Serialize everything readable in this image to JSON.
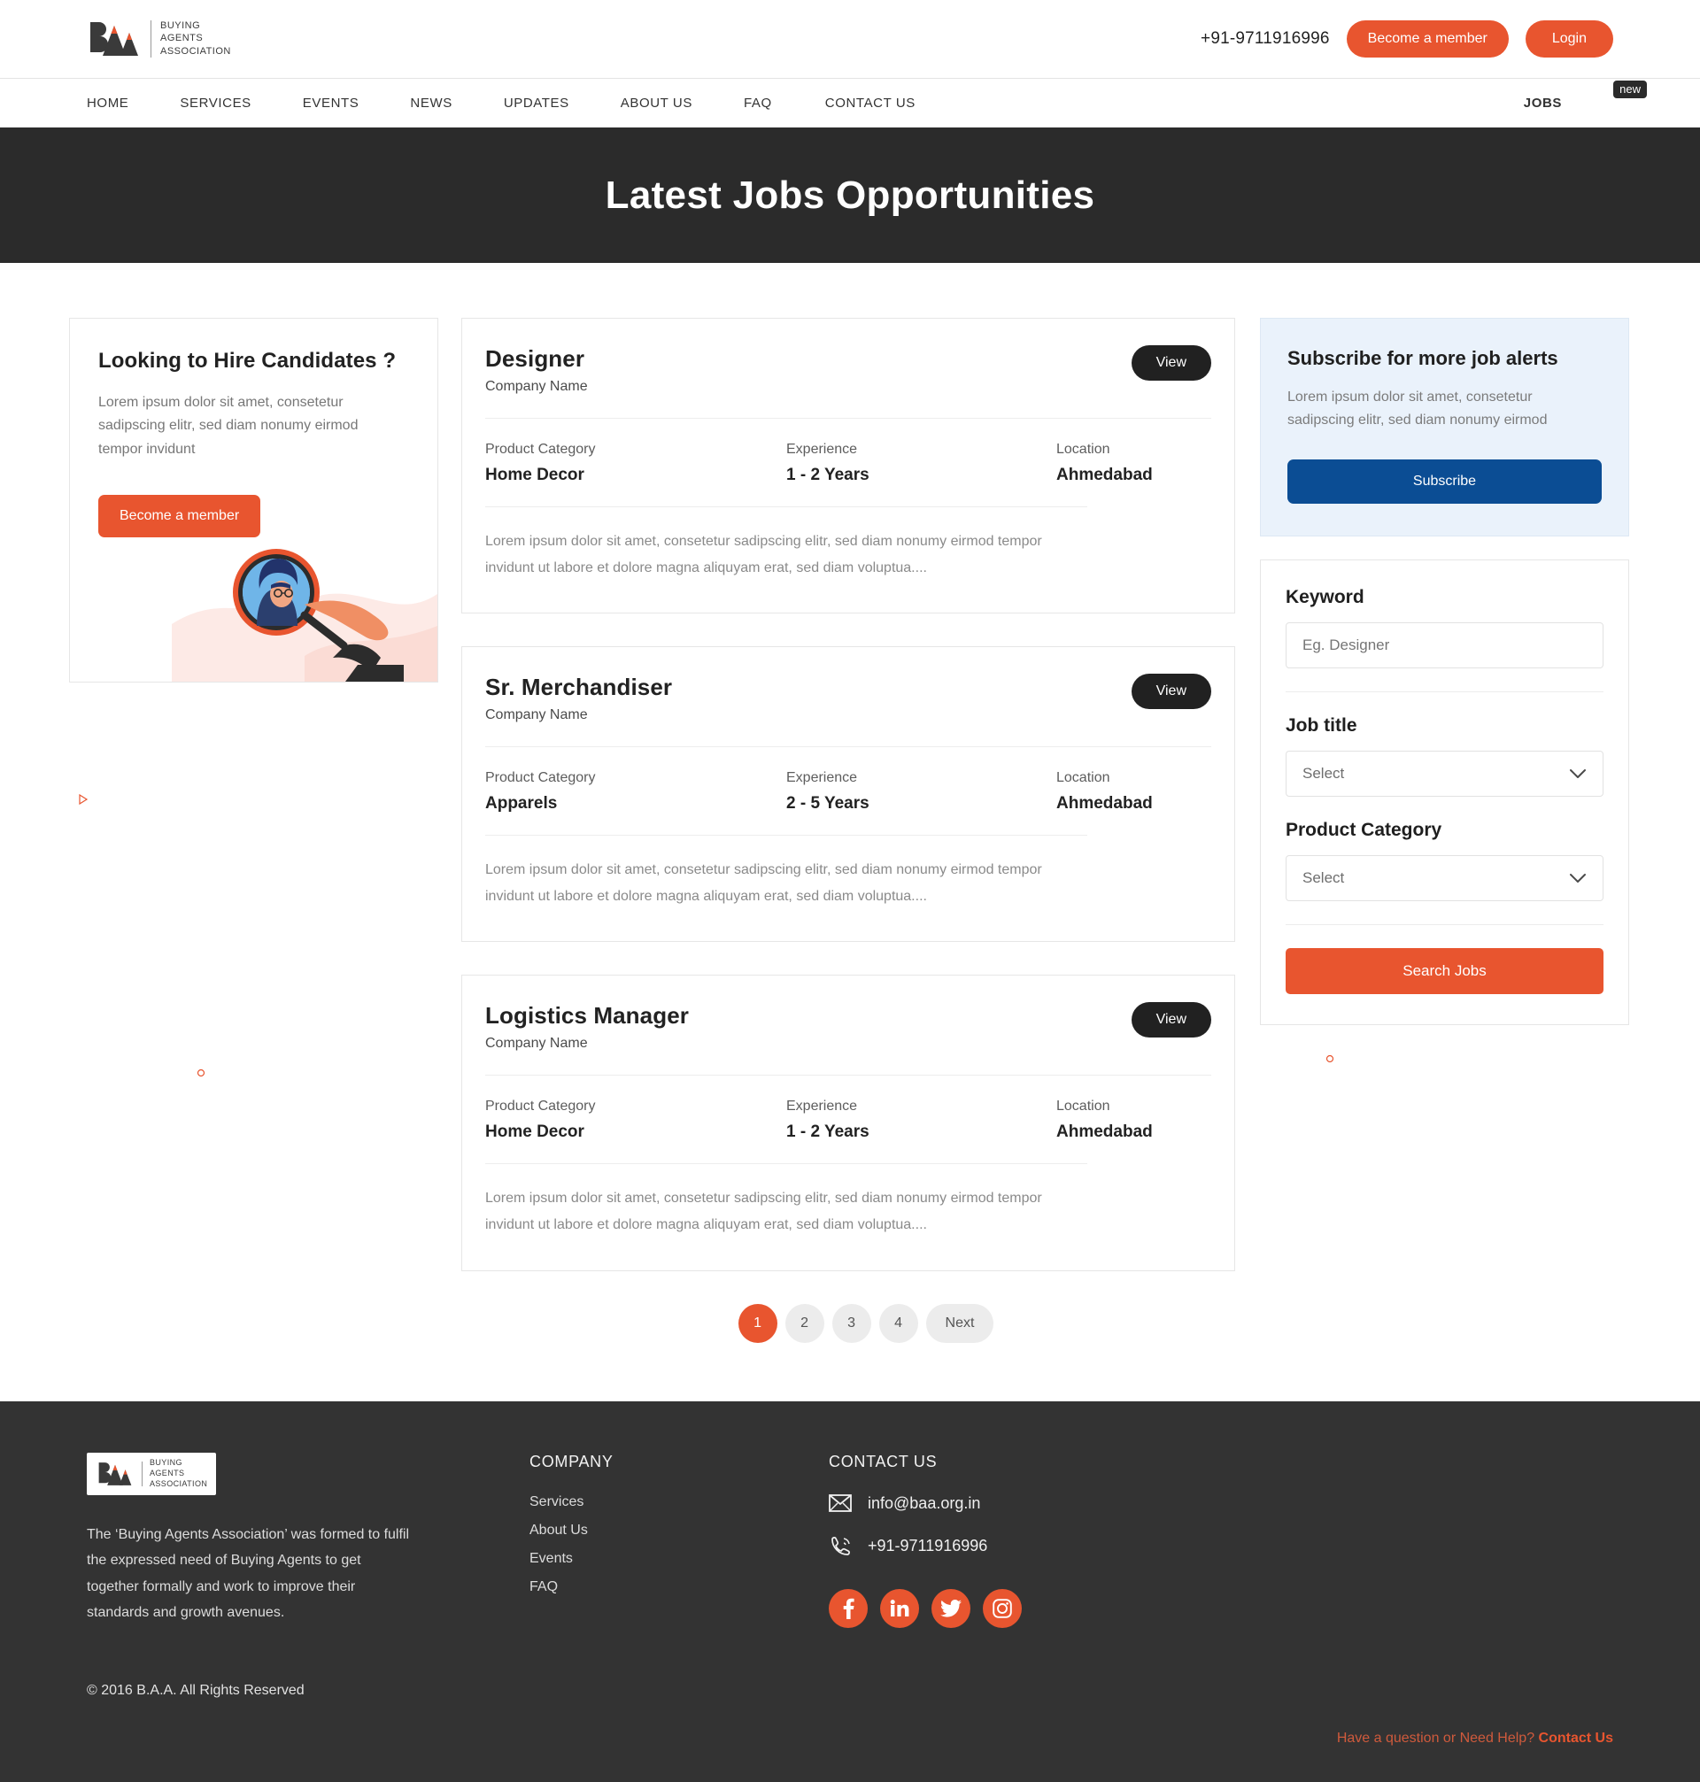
{
  "header": {
    "logo": {
      "line1": "BUYING",
      "line2": "AGENTS",
      "line3": "ASSOCIATION",
      "mark_text": "BAA"
    },
    "phone": "+91-9711916996",
    "become_member_label": "Become a member",
    "login_label": "Login"
  },
  "nav": {
    "items": [
      "HOME",
      "SERVICES",
      "EVENTS",
      "NEWS",
      "UPDATES",
      "ABOUT US",
      "FAQ",
      "CONTACT US"
    ],
    "jobs_label": "JOBS",
    "jobs_badge": "new"
  },
  "hero": {
    "title": "Latest Jobs Opportunities"
  },
  "hire_card": {
    "title": "Looking to Hire Candidates ?",
    "body": "Lorem ipsum dolor sit amet, consetetur sadipscing elitr, sed diam nonumy eirmod tempor invidunt",
    "button": "Become a member"
  },
  "job_list": {
    "view_label": "View",
    "labels": {
      "category": "Product Category",
      "experience": "Experience",
      "location": "Location"
    },
    "jobs": [
      {
        "title": "Designer",
        "company": "Company Name",
        "category": "Home Decor",
        "experience": "1 - 2 Years",
        "location": "Ahmedabad",
        "description": "Lorem ipsum dolor sit amet, consetetur sadipscing elitr, sed diam nonumy eirmod tempor invidunt ut labore et dolore magna aliquyam erat, sed diam voluptua...."
      },
      {
        "title": "Sr. Merchandiser",
        "company": "Company Name",
        "category": "Apparels",
        "experience": "2 - 5 Years",
        "location": "Ahmedabad",
        "description": "Lorem ipsum dolor sit amet, consetetur sadipscing elitr, sed diam nonumy eirmod tempor invidunt ut labore et dolore magna aliquyam erat, sed diam voluptua...."
      },
      {
        "title": "Logistics Manager",
        "company": "Company Name",
        "category": "Home Decor",
        "experience": "1 - 2 Years",
        "location": "Ahmedabad",
        "description": "Lorem ipsum dolor sit amet, consetetur sadipscing elitr, sed diam nonumy eirmod tempor invidunt ut labore et dolore magna aliquyam erat, sed diam voluptua...."
      }
    ]
  },
  "pagination": {
    "pages": [
      "1",
      "2",
      "3",
      "4"
    ],
    "next_label": "Next",
    "current": "1"
  },
  "subscribe": {
    "title": "Subscribe for more job alerts",
    "body": "Lorem ipsum dolor sit amet, consetetur sadipscing elitr, sed diam nonumy eirmod",
    "button": "Subscribe"
  },
  "filters": {
    "keyword_label": "Keyword",
    "keyword_placeholder": "Eg. Designer",
    "keyword_value": "",
    "job_title_label": "Job title",
    "job_title_value": "Select",
    "product_category_label": "Product Category",
    "product_category_value": "Select",
    "search_button": "Search Jobs"
  },
  "footer": {
    "logo": {
      "line1": "BUYING",
      "line2": "AGENTS",
      "line3": "ASSOCIATION"
    },
    "about": "The ‘Buying Agents Association’ was formed to fulfil the expressed need of Buying Agents to get together formally and work to improve their standards and growth avenues.",
    "copyright": "© 2016 B.A.A. All Rights Reserved",
    "company_heading": "COMPANY",
    "company_links": [
      "Services",
      "About Us",
      "Events",
      "FAQ"
    ],
    "contact_heading": "CONTACT US",
    "email": "info@baa.org.in",
    "phone": "+91-9711916996",
    "help_text": "Have a question or Need Help? ",
    "help_link": "Contact Us",
    "socials": [
      "facebook",
      "linkedin",
      "twitter",
      "instagram"
    ]
  },
  "colors": {
    "accent": "#e8552f",
    "dark": "#2b2b2b",
    "footer_bg": "#333333",
    "subscribe_bg": "#eaf2fb",
    "subscribe_btn": "#0b4d94"
  }
}
